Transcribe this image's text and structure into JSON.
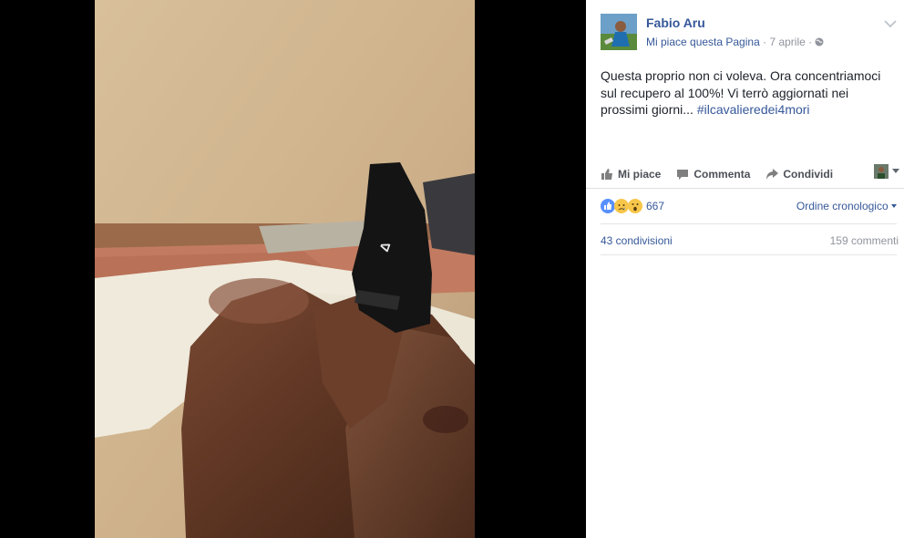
{
  "post": {
    "author": "Fabio Aru",
    "like_page": "Mi piace questa Pagina",
    "separator": "·",
    "date": "7 aprile",
    "separator2": "·",
    "text": "Questa proprio non ci voleva. Ora concentriamoci sul recupero al 100%! Vi terrò aggiornati nei prossimi giorni...",
    "hashtag": "#ilcavalieredei4mori"
  },
  "actions": {
    "like": "Mi piace",
    "comment": "Commenta",
    "share": "Condividi"
  },
  "stats": {
    "reactions_count": "667",
    "order": "Ordine cronologico",
    "shares": "43 condivisioni",
    "comments": "159 commenti"
  },
  "icons": {
    "reactions": [
      "like-icon",
      "sad-icon",
      "wow-icon"
    ],
    "privacy": "globe-icon"
  },
  "colors": {
    "link": "#365899",
    "text": "#1d2129",
    "muted": "#90949c",
    "like_blue": "#5890ff",
    "emoji_yellow": "#f7c64a"
  }
}
